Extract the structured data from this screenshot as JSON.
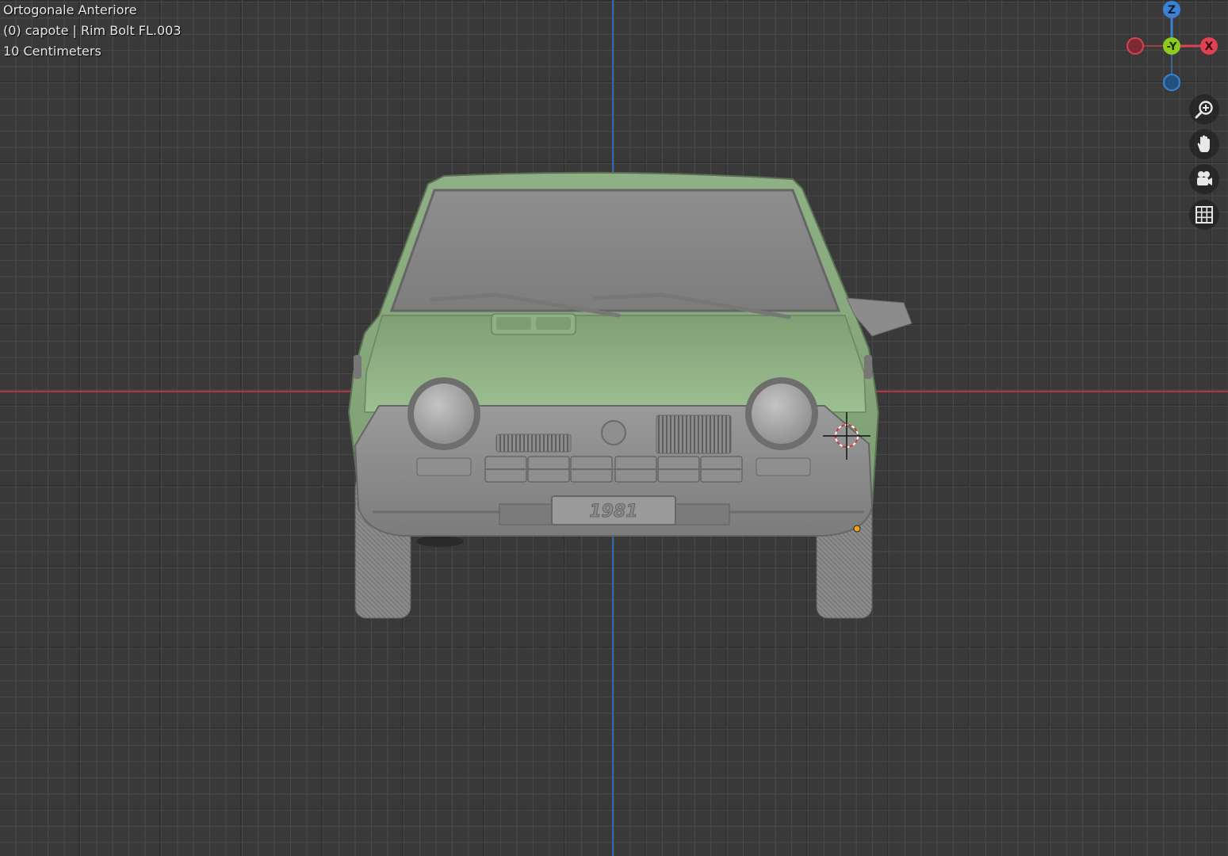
{
  "viewport": {
    "view_name": "Ortogonale Anteriore",
    "object_info": "(0) capote | Rim Bolt FL.003",
    "grid_scale": "10 Centimeters"
  },
  "gizmo": {
    "z_label": "Z",
    "y_label": "-Y",
    "x_label": "X",
    "colors": {
      "x": "#e0404f",
      "y": "#8ccc1c",
      "z": "#3b82d6"
    }
  },
  "navigation": [
    {
      "name": "zoom-icon"
    },
    {
      "name": "pan-hand-icon"
    },
    {
      "name": "camera-icon"
    },
    {
      "name": "grid-perspective-icon"
    }
  ],
  "model": {
    "plate_text": "1981",
    "body_color": "#8aac7f",
    "trim_color": "#8c8c8c"
  }
}
